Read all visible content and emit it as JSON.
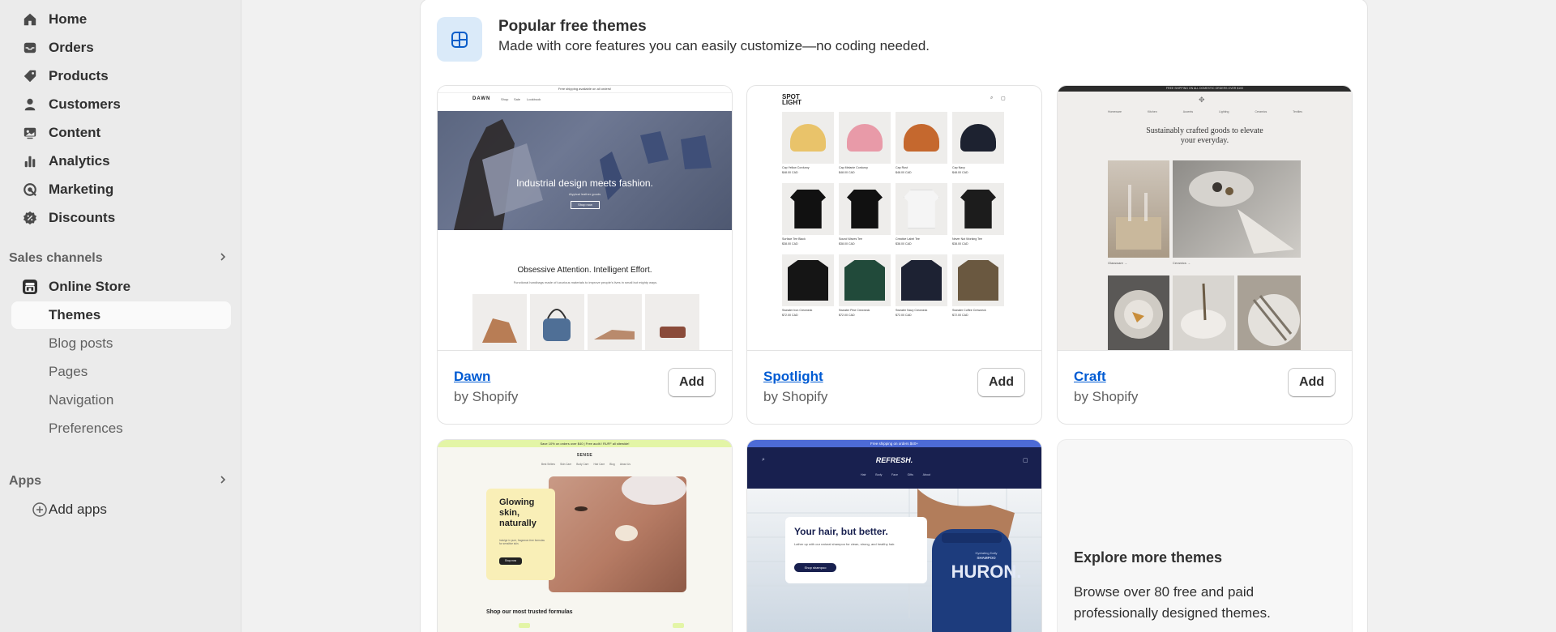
{
  "sidebar": {
    "items": [
      {
        "label": "Home",
        "icon": "home-icon"
      },
      {
        "label": "Orders",
        "icon": "inbox-icon"
      },
      {
        "label": "Products",
        "icon": "tag-icon"
      },
      {
        "label": "Customers",
        "icon": "person-icon"
      },
      {
        "label": "Content",
        "icon": "content-icon"
      },
      {
        "label": "Analytics",
        "icon": "bar-chart-icon"
      },
      {
        "label": "Marketing",
        "icon": "target-icon"
      },
      {
        "label": "Discounts",
        "icon": "discount-icon"
      }
    ],
    "sales_channels": {
      "label": "Sales channels",
      "online_store": "Online Store",
      "sub_items": [
        "Themes",
        "Blog posts",
        "Pages",
        "Navigation",
        "Preferences"
      ],
      "active": "Themes"
    },
    "apps": {
      "label": "Apps",
      "add_apps": "Add apps"
    }
  },
  "main": {
    "title": "Popular free themes",
    "subtitle": "Made with core features you can easily customize—no coding needed.",
    "themes": [
      {
        "name": "Dawn",
        "by": "by Shopify",
        "add": "Add",
        "preview": {
          "announcement": "Free shipping available on all orders!",
          "logo": "DAWN",
          "nav": [
            "Shop",
            "Sale",
            "Lookbook"
          ],
          "hero_text": "Industrial design meets fashion.",
          "hero_sub": "Atypical leather goods",
          "hero_button": "Shop now",
          "section_title": "Obsessive Attention. Intelligent Effort.",
          "section_sub": "Functional handbags made of luxurious materials to improve people's lives in small but mighty ways."
        }
      },
      {
        "name": "Spotlight",
        "by": "by Shopify",
        "add": "Add",
        "preview": {
          "logo_line1": "SPOT",
          "logo_line2": "LIGHT",
          "products": [
            {
              "name": "Cap Yellow Corduroy",
              "price": "$48.00 CAD"
            },
            {
              "name": "Cap Melanie Corduroy",
              "price": "$48.00 CAD"
            },
            {
              "name": "Cap Rust",
              "price": "$48.00 CAD"
            },
            {
              "name": "Cap Navy",
              "price": "$48.00 CAD"
            },
            {
              "name": "Surface Tee Black",
              "price": "$38.00 CAD"
            },
            {
              "name": "Sound Waves Tee",
              "price": "$38.00 CAD"
            },
            {
              "name": "Creative Label Tee",
              "price": "$38.00 CAD"
            },
            {
              "name": "Never Not Working Tee",
              "price": "$38.00 CAD"
            },
            {
              "name": "Sweater Iron Crewneck",
              "price": "$72.00 CAD"
            },
            {
              "name": "Sweater Pine Crewneck",
              "price": "$72.00 CAD"
            },
            {
              "name": "Sweater Navy Crewneck",
              "price": "$72.00 CAD"
            },
            {
              "name": "Sweater Coffee Crewneck",
              "price": "$72.00 CAD"
            }
          ]
        }
      },
      {
        "name": "Craft",
        "by": "by Shopify",
        "add": "Add",
        "preview": {
          "announcement": "FREE SHIPPING ON ALL DOMESTIC ORDERS OVER $100",
          "nav": [
            "Homeware",
            "Kitchen",
            "Accents",
            "Lighting",
            "Ceramics",
            "Textiles"
          ],
          "headline_line1": "Sustainably crafted goods to elevate",
          "headline_line2": "your everyday.",
          "caption_left": "Glassware →",
          "caption_right": "Ceramics →"
        }
      }
    ],
    "row2": [
      {
        "preview": {
          "announcement": "Save 10% on orders over $40 | Free audit / RUFF all sitewide!",
          "logo": "SENSE",
          "nav": [
            "Best Sellers",
            "Skin Care",
            "Body Care",
            "Hair Care",
            "Blog",
            "About Us"
          ],
          "hero_title": "Glowing skin, naturally",
          "hero_sub": "Indulge in pure, fragrance-free formulas for sensitive skin.",
          "hero_button": "Shop now",
          "section": "Shop our most trusted formulas"
        }
      },
      {
        "preview": {
          "announcement": "Free shipping on orders $40+",
          "logo": "REFRESH.",
          "nav": [
            "Hair",
            "Body",
            "Face",
            "Gifts",
            "About"
          ],
          "hero_title": "Your hair, but better.",
          "hero_sub": "Lather up with our natural shampoo for clean, strong, and healthy hair.",
          "hero_button": "Shop shampoo",
          "bottle_label1": "Hydrating Daily",
          "bottle_label2": "SHAMPOO",
          "bottle_brand": "HURON."
        }
      }
    ],
    "explore": {
      "title": "Explore more themes",
      "description": "Browse over 80 free and paid professionally designed themes."
    }
  },
  "colors": {
    "accent_link": "#005bd3",
    "sidebar_bg": "#ebebeb",
    "page_bg": "#f1f1f1",
    "header_icon_bg": "#daeaf9",
    "refresh_navy": "#18204f",
    "refresh_blue_bar": "#4d6bd6",
    "sense_green_bar": "#e3f5a6"
  }
}
